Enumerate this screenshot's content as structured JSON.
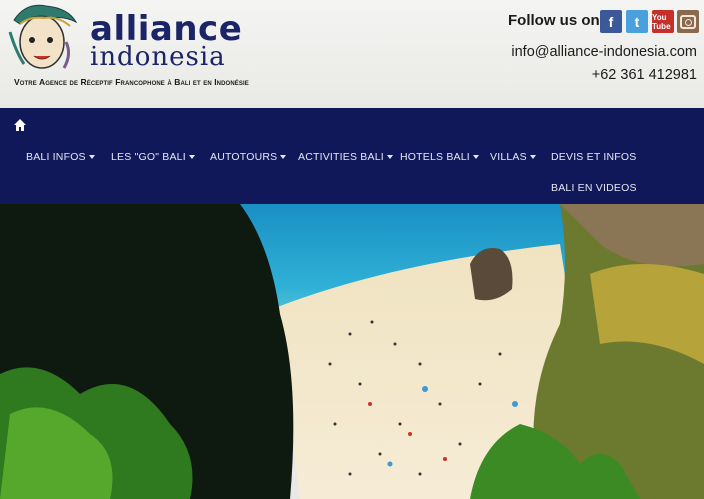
{
  "header": {
    "brand_top": "alliance",
    "brand_bottom": "indonesia",
    "tagline": "Votre Agence de Réceptif Francophone à Bali et en Indonésie",
    "follow_label": "Follow us on",
    "social": {
      "facebook_glyph": "f",
      "twitter_glyph": "t",
      "youtube_glyph": "You Tube"
    },
    "email": "info@alliance-indonesia.com",
    "phone": "+62 361 412981"
  },
  "nav": {
    "home_icon": "home-icon",
    "items": [
      {
        "label": "BALI INFOS",
        "dropdown": true
      },
      {
        "label": "LES \"GO\" BALI",
        "dropdown": true
      },
      {
        "label": "AUTOTOURS",
        "dropdown": true
      },
      {
        "label": "ACTIVITIES BALI",
        "dropdown": true
      },
      {
        "label": "HOTELS BALI",
        "dropdown": true
      },
      {
        "label": "VILLAS",
        "dropdown": true
      },
      {
        "label": "DEVIS ET INFOS",
        "dropdown": false
      },
      {
        "label": "BALI EN VIDEOS",
        "dropdown": false
      }
    ]
  },
  "colors": {
    "nav_bg": "#10185a",
    "brand": "#1a2466"
  }
}
